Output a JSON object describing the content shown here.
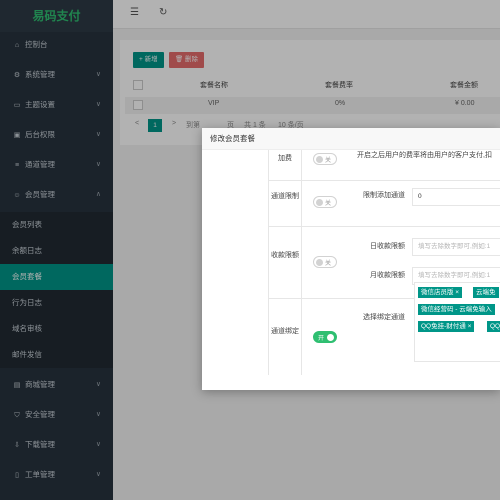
{
  "sidebar": {
    "logo": "易码支付",
    "items": [
      {
        "label": "控制台",
        "icon": "home-icon",
        "chev": ""
      },
      {
        "label": "系统管理",
        "icon": "gear-icon",
        "chev": "∨"
      },
      {
        "label": "主题设置",
        "icon": "monitor-icon",
        "chev": "∨"
      },
      {
        "label": "后台权限",
        "icon": "lock-icon",
        "chev": "∨"
      },
      {
        "label": "通道管理",
        "icon": "list-icon",
        "chev": "∨"
      },
      {
        "label": "会员管理",
        "icon": "users-icon",
        "chev": "∧"
      }
    ],
    "subitems": [
      {
        "label": "会员列表"
      },
      {
        "label": "余额日志"
      },
      {
        "label": "会员套餐"
      },
      {
        "label": "行为日志"
      },
      {
        "label": "域名审核"
      },
      {
        "label": "邮件发信"
      }
    ],
    "items_bottom": [
      {
        "label": "商城管理",
        "icon": "cart-icon",
        "chev": "∨"
      },
      {
        "label": "安全管理",
        "icon": "shield-icon",
        "chev": "∨"
      },
      {
        "label": "下载管理",
        "icon": "download-icon",
        "chev": "∨"
      },
      {
        "label": "工单管理",
        "icon": "ticket-icon",
        "chev": "∨"
      }
    ]
  },
  "topbar": {
    "menu_icon": "☰",
    "refresh_icon": "↻"
  },
  "toolbar": {
    "add_label": "+ 新增",
    "delete_label": "🗑 删除"
  },
  "table": {
    "headers": [
      "套餐名称",
      "套餐费率",
      "套餐金额"
    ],
    "row": [
      "VIP",
      "0%",
      "¥ 0.00"
    ],
    "pager": {
      "prev": "<",
      "current": "1",
      "next": ">",
      "goto": "到第",
      "page_unit": "页",
      "total": "共 1 条",
      "per_page": "10 条/页"
    }
  },
  "modal": {
    "title": "修改会员套餐",
    "top_label": "加费",
    "top_switch": "关",
    "top_note": "开启之后用户的费率将由用户的客户支付,扣",
    "channel_limit": {
      "label": "通道限制",
      "switch": "关",
      "field_label": "限制添加通道",
      "field_value": "0"
    },
    "collect_limit": {
      "label": "收款限额",
      "switch": "关",
      "daily_label": "日收款限额",
      "daily_placeholder": "填写去除数字即可,例如:1",
      "monthly_label": "月收款限额",
      "monthly_placeholder": "填写去除数字即可,例如:1"
    },
    "channel_bind": {
      "label": "通道绑定",
      "switch": "开",
      "field_label": "选择绑定通道",
      "tags": [
        "微信店员版 ×",
        "云端免",
        "微信经营码 - 云端免输入",
        "QQ免挂-财付通 ×",
        "QQ"
      ]
    }
  },
  "colors": {
    "accent": "#009688",
    "danger": "#e66c6c",
    "sidebar": "#28333e",
    "brand": "#2fbf71"
  }
}
